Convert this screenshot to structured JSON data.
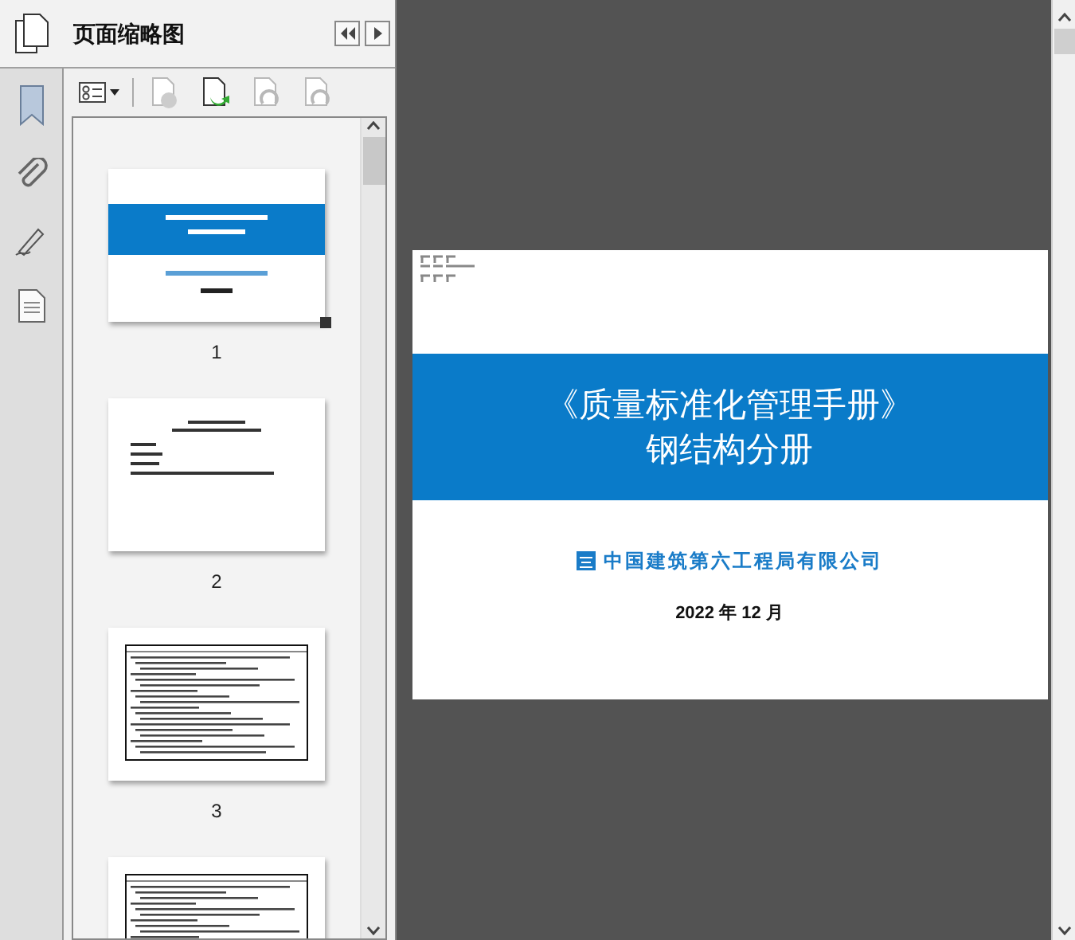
{
  "panel": {
    "title": "页面缩略图"
  },
  "toolbar": [
    {
      "kind": "options",
      "disabled": false
    },
    {
      "kind": "delete",
      "disabled": true
    },
    {
      "kind": "insert",
      "disabled": false
    },
    {
      "kind": "undo",
      "disabled": true
    },
    {
      "kind": "redo",
      "disabled": true
    }
  ],
  "thumbnails": [
    {
      "label": "1",
      "kind": "cover",
      "selected": true
    },
    {
      "label": "2",
      "kind": "text",
      "selected": false
    },
    {
      "label": "3",
      "kind": "table",
      "selected": false
    },
    {
      "kind": "table",
      "selected": false
    }
  ],
  "document": {
    "title": "《质量标准化管理手册》",
    "subtitle": "钢结构分册",
    "company": "中国建筑第六工程局有限公司",
    "date": "2022 年 12 月"
  }
}
